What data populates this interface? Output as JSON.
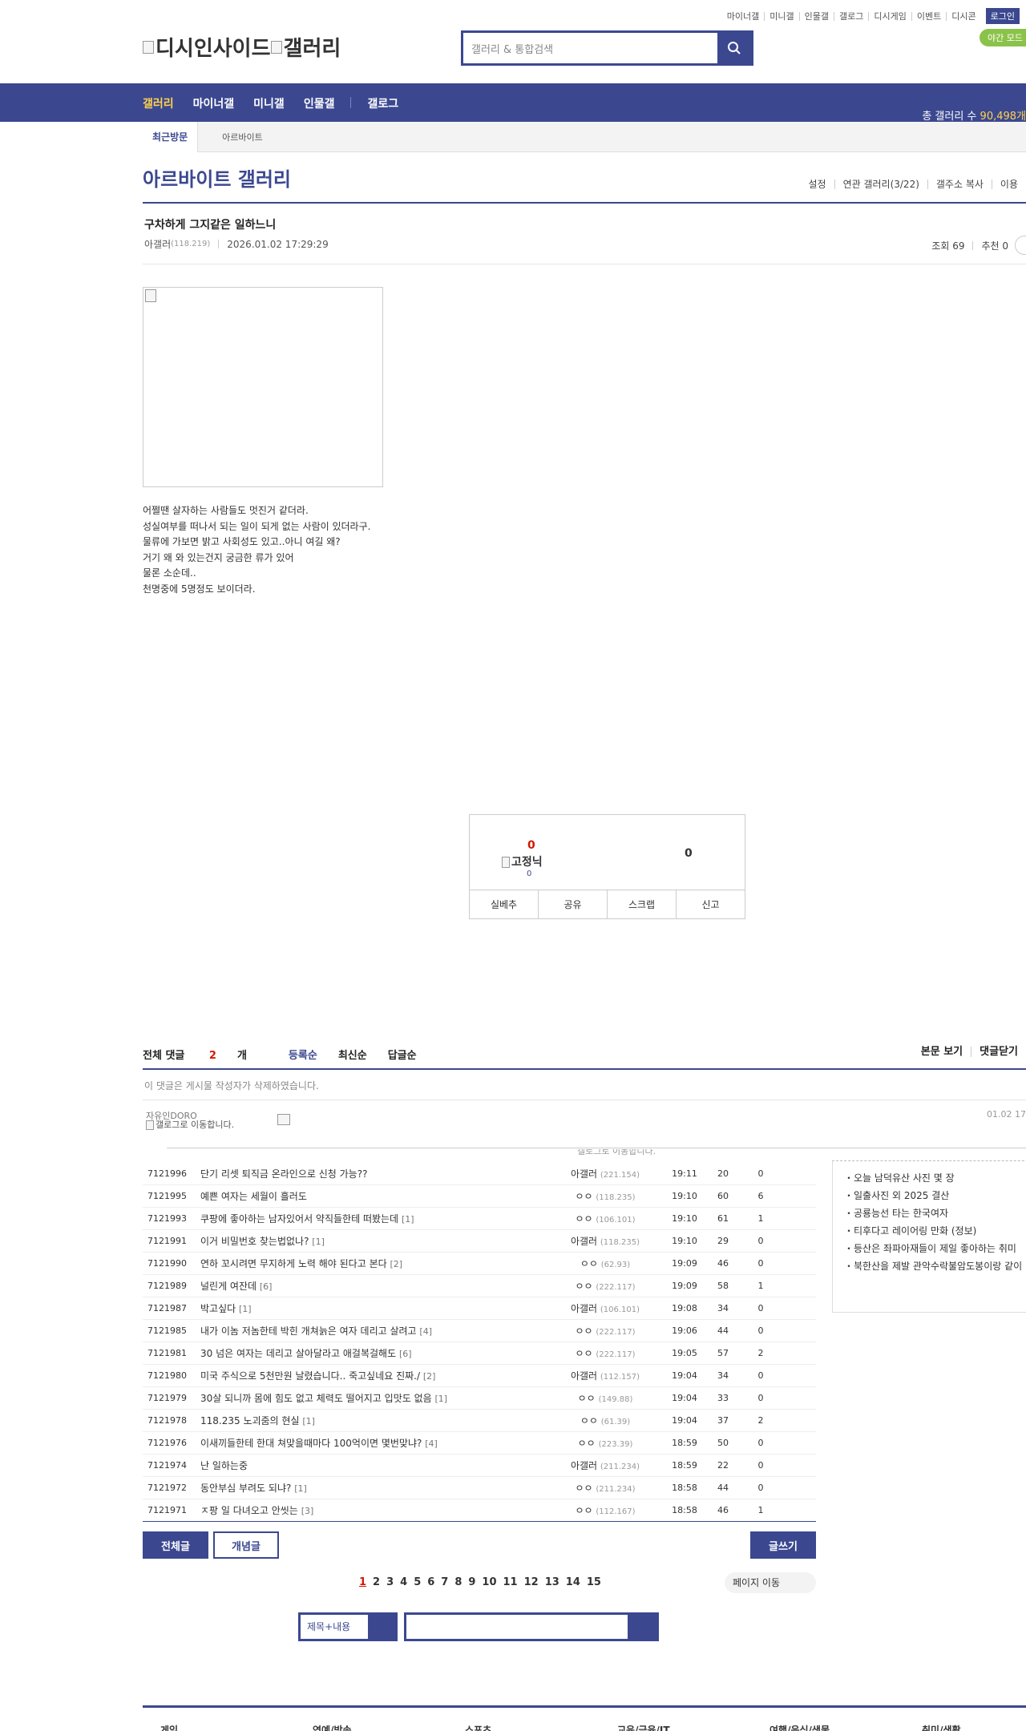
{
  "top_links": [
    "마이너갤",
    "미니갤",
    "인물갤",
    "갤로그",
    "디시게임",
    "이벤트",
    "디시콘"
  ],
  "login_label": "로그인",
  "night_label": "야간 모드",
  "logo": {
    "left": "디시인사이드",
    "right": "갤러리"
  },
  "search": {
    "placeholder": "갤러리 & 통합검색"
  },
  "gnb": {
    "items": [
      "갤러리",
      "마이너갤",
      "미니갤",
      "인물갤"
    ],
    "gallog": "갤로그",
    "count_label": "총 갤러리 수",
    "count_value": "90,498개"
  },
  "recent": {
    "title": "최근방문",
    "item": "아르바이트"
  },
  "gallery": {
    "title": "아르바이트 갤러리",
    "buttons": [
      "설정",
      "연관 갤러리(3/22)",
      "갤주소 복사",
      "이용"
    ]
  },
  "post": {
    "title": "구차하게 그지같은 일하느니",
    "author": "아갤러",
    "ip": "(118.219)",
    "date": "2026.01.02 17:29:29",
    "views_label": "조회 69",
    "recommend_label": "추천 0",
    "body": [
      "어쩔땐 살자하는 사람들도 멋진거 같더라.",
      "성실여부를 떠나서 되는 일이 되게 없는 사람이 있더라구.",
      "물류에 가보면 밝고 사회성도 있고..아니 여길 왜?",
      "거기 왜 와 있는건지 궁금한 류가 있어",
      "물론 소순데..",
      "천명중에 5명정도 보이더라."
    ]
  },
  "vote": {
    "up": "0",
    "gname": "고정닉",
    "gsub": "0",
    "down": "0",
    "buttons": [
      "실베추",
      "공유",
      "스크랩",
      "신고"
    ]
  },
  "comments": {
    "total_label": "전체 댓글",
    "count": "2",
    "unit": "개",
    "sorts": [
      "등록순",
      "최신순",
      "답글순"
    ],
    "right": [
      "본문 보기",
      "댓글닫기"
    ],
    "deleted": "이 댓글은 게시물 작성자가 삭제하였습니다.",
    "user": "자유인DORO",
    "user_link": "갤로그로 이동합니다.",
    "time": "01.02 17",
    "banner": "갤로그로 이동합니다."
  },
  "posts": [
    {
      "no": "7121996",
      "subject": "단기 리셋 퇴직금 온라인으로 신청 가능??",
      "reply": "",
      "writer": "아갤러",
      "ip": "(221.154)",
      "date": "19:11",
      "views": "20",
      "rec": "0"
    },
    {
      "no": "7121995",
      "subject": "예쁜 여자는 세월이 흘러도",
      "reply": "",
      "writer": "ㅇㅇ",
      "ip": "(118.235)",
      "date": "19:10",
      "views": "60",
      "rec": "6"
    },
    {
      "no": "7121993",
      "subject": "쿠팡에 좋아하는 남자있어서 약직들한테 떠봤는데",
      "reply": "[1]",
      "writer": "ㅇㅇ",
      "ip": "(106.101)",
      "date": "19:10",
      "views": "61",
      "rec": "1"
    },
    {
      "no": "7121991",
      "subject": "이거 비밀번호 찾는법없나?",
      "reply": "[1]",
      "writer": "아갤러",
      "ip": "(118.235)",
      "date": "19:10",
      "views": "29",
      "rec": "0"
    },
    {
      "no": "7121990",
      "subject": "연하 꼬시려면 무지하게 노력 해야 된다고 본다",
      "reply": "[2]",
      "writer": "ㅇㅇ",
      "ip": "(62.93)",
      "date": "19:09",
      "views": "46",
      "rec": "0"
    },
    {
      "no": "7121989",
      "subject": "널린게 여잔데",
      "reply": "[6]",
      "writer": "ㅇㅇ",
      "ip": "(222.117)",
      "date": "19:09",
      "views": "58",
      "rec": "1"
    },
    {
      "no": "7121987",
      "subject": "박고싶다",
      "reply": "[1]",
      "writer": "아갤러",
      "ip": "(106.101)",
      "date": "19:08",
      "views": "34",
      "rec": "0"
    },
    {
      "no": "7121985",
      "subject": "내가 이놈 저놈한테 박힌 개쳐늙은 여자 데리고 살려고",
      "reply": "[4]",
      "writer": "ㅇㅇ",
      "ip": "(222.117)",
      "date": "19:06",
      "views": "44",
      "rec": "0"
    },
    {
      "no": "7121981",
      "subject": "30 넘은 여자는 데리고 살아달라고 애걸복걸해도",
      "reply": "[6]",
      "writer": "ㅇㅇ",
      "ip": "(222.117)",
      "date": "19:05",
      "views": "57",
      "rec": "2"
    },
    {
      "no": "7121980",
      "subject": "미국 주식으로 5천만원 날렸습니다.. 죽고싶네요 진짜./",
      "reply": "[2]",
      "writer": "아갤러",
      "ip": "(112.157)",
      "date": "19:04",
      "views": "34",
      "rec": "0"
    },
    {
      "no": "7121979",
      "subject": "30살 되니까 몸에 힘도 없고 체력도 떨어지고 입맛도 없음",
      "reply": "[1]",
      "writer": "ㅇㅇ",
      "ip": "(149.88)",
      "date": "19:04",
      "views": "33",
      "rec": "0"
    },
    {
      "no": "7121978",
      "subject": "118.235 노괴줌의 현실",
      "reply": "[1]",
      "writer": "ㅇㅇ",
      "ip": "(61.39)",
      "date": "19:04",
      "views": "37",
      "rec": "2"
    },
    {
      "no": "7121976",
      "subject": "이새끼들한테 한대 쳐맞을때마다 100억이면 몇번맞냐?",
      "reply": "[4]",
      "writer": "ㅇㅇ",
      "ip": "(223.39)",
      "date": "18:59",
      "views": "50",
      "rec": "0"
    },
    {
      "no": "7121974",
      "subject": "난 일하는중",
      "reply": "",
      "writer": "아갤러",
      "ip": "(211.234)",
      "date": "18:59",
      "views": "22",
      "rec": "0"
    },
    {
      "no": "7121972",
      "subject": "동안부심 부려도 되냐?",
      "reply": "[1]",
      "writer": "ㅇㅇ",
      "ip": "(211.234)",
      "date": "18:58",
      "views": "44",
      "rec": "0"
    },
    {
      "no": "7121971",
      "subject": "ㅈ팡 일 다녀오고 안씻는",
      "reply": "[3]",
      "writer": "ㅇㅇ",
      "ip": "(112.167)",
      "date": "18:58",
      "views": "46",
      "rec": "1"
    }
  ],
  "side_news": [
    "오늘 남덕유산 사진 몇 장",
    "일출사진 외 2025 결산",
    "공룡능선 타는 한국여자",
    "티후다고 레이어링 만화 (정보)",
    "등산은 좌파아재들이 제일 좋아하는 취미",
    "북한산을 제발 관악수락불암도봉이랑 같이"
  ],
  "buttons": {
    "all": "전체글",
    "concept": "개념글",
    "write": "글쓰기"
  },
  "paging": [
    "1",
    "2",
    "3",
    "4",
    "5",
    "6",
    "7",
    "8",
    "9",
    "10",
    "11",
    "12",
    "13",
    "14",
    "15"
  ],
  "page_move": "페이지 이동",
  "bottom_search": {
    "type": "제목+내용"
  },
  "footer_cats": [
    "게임",
    "연예/방송",
    "스포츠",
    "교육/금융/IT",
    "여행/음식/생물",
    "취미/생활"
  ],
  "colors": {
    "brand": "#3b4890",
    "accent": "#d31900",
    "night": "#8bc34a"
  }
}
